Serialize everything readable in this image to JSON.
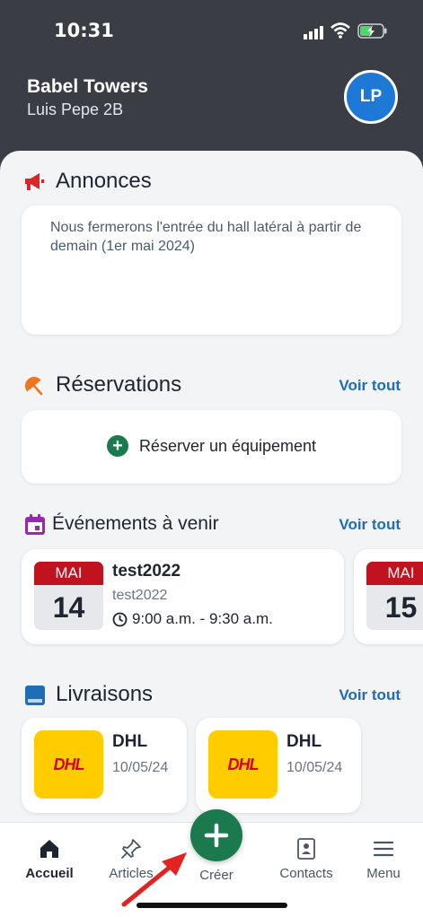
{
  "status_bar": {
    "time": "10:31"
  },
  "header": {
    "building": "Babel Towers",
    "resident": "Luis Pepe  2B",
    "avatar_initials": "LP"
  },
  "announcements": {
    "title": "Annonces",
    "text": "Nous fermerons l'entrée du hall latéral à partir de demain (1er mai 2024)"
  },
  "reservations": {
    "title": "Réservations",
    "see_all": "Voir tout",
    "action_label": "Réserver un équipement"
  },
  "events": {
    "title": "Événements à venir",
    "see_all": "Voir tout",
    "items": [
      {
        "month": "MAI",
        "day": "14",
        "title": "test2022",
        "subtitle": "test2022",
        "time": "9:00 a.m. - 9:30 a.m."
      },
      {
        "month": "MAI",
        "day": "15"
      }
    ]
  },
  "deliveries": {
    "title": "Livraisons",
    "see_all": "Voir tout",
    "items": [
      {
        "logo": "DHL",
        "carrier": "DHL",
        "date": "10/05/24"
      },
      {
        "logo": "DHL",
        "carrier": "DHL",
        "date": "10/05/24"
      }
    ]
  },
  "bottom_nav": {
    "home": "Accueil",
    "articles": "Articles",
    "create": "Créer",
    "contacts": "Contacts",
    "menu": "Menu"
  },
  "colors": {
    "accent_green": "#1a7a4d",
    "link_blue": "#1f6db5",
    "header_bg": "#3b3d45",
    "date_red": "#c1121f",
    "dhl_yellow": "#ffcc00"
  }
}
